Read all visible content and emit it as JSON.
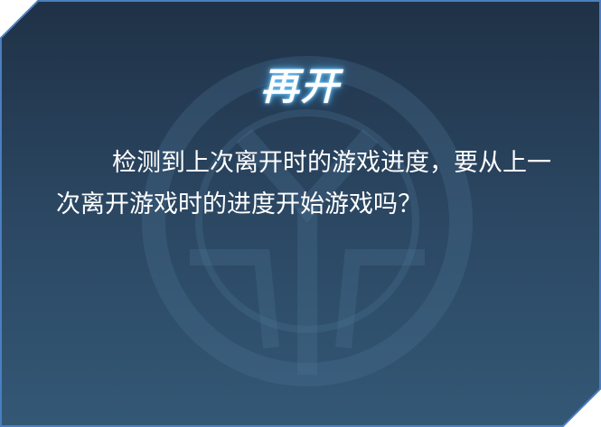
{
  "dialog": {
    "title": "再开",
    "message": "检测到上次离开时的游戏进度，要从上一次离开游戏时的进度开始游戏吗？"
  },
  "colors": {
    "background_top": "#1f3146",
    "background_bottom": "#335876",
    "border": "#4a7fc0",
    "title_glow": "#6fc6ff",
    "text": "#ffffff"
  },
  "icons": {
    "background_emblem": "circular-crest-emblem"
  }
}
